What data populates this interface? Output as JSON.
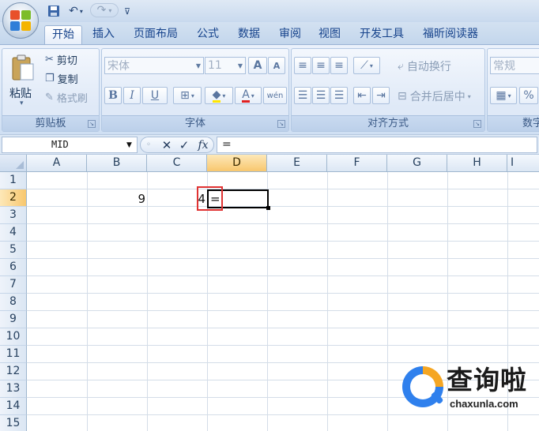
{
  "quick_access": {
    "save_icon": "save-icon",
    "undo_icon": "undo-icon",
    "redo_icon": "redo-icon",
    "customize_icon": "customize-icon"
  },
  "tabs": [
    {
      "label": "开始",
      "active": true
    },
    {
      "label": "插入"
    },
    {
      "label": "页面布局"
    },
    {
      "label": "公式"
    },
    {
      "label": "数据"
    },
    {
      "label": "审阅"
    },
    {
      "label": "视图"
    },
    {
      "label": "开发工具"
    },
    {
      "label": "福昕阅读器"
    }
  ],
  "ribbon": {
    "clipboard": {
      "label": "剪贴板",
      "paste": "粘贴",
      "cut": "剪切",
      "copy": "复制",
      "format_painter": "格式刷"
    },
    "font": {
      "label": "字体",
      "font_name": "宋体",
      "font_size": "11",
      "grow": "A",
      "shrink": "A",
      "bold": "B",
      "italic": "I",
      "underline": "U",
      "font_color": "A",
      "wen": "wén"
    },
    "alignment": {
      "label": "对齐方式",
      "wrap_text": "自动换行",
      "merge_center": "合并后居中"
    },
    "number": {
      "label": "数字",
      "format": "常规",
      "percent": "%"
    }
  },
  "formula_bar": {
    "name_box": "MID",
    "cancel": "✕",
    "enter": "✓",
    "fx": "fx",
    "formula": "="
  },
  "grid": {
    "columns": [
      "A",
      "B",
      "C",
      "D",
      "E",
      "F",
      "G",
      "H",
      "I"
    ],
    "selected_column": "D",
    "rows": [
      "1",
      "2",
      "3",
      "4",
      "5",
      "6",
      "7",
      "8",
      "9",
      "10",
      "11",
      "12",
      "13",
      "14",
      "15"
    ],
    "selected_row": "2",
    "cells": {
      "B2": "9",
      "C2": "4",
      "D2": "="
    }
  },
  "watermark": {
    "brand_cn": "查询啦",
    "brand_en": "chaxunla.com"
  }
}
